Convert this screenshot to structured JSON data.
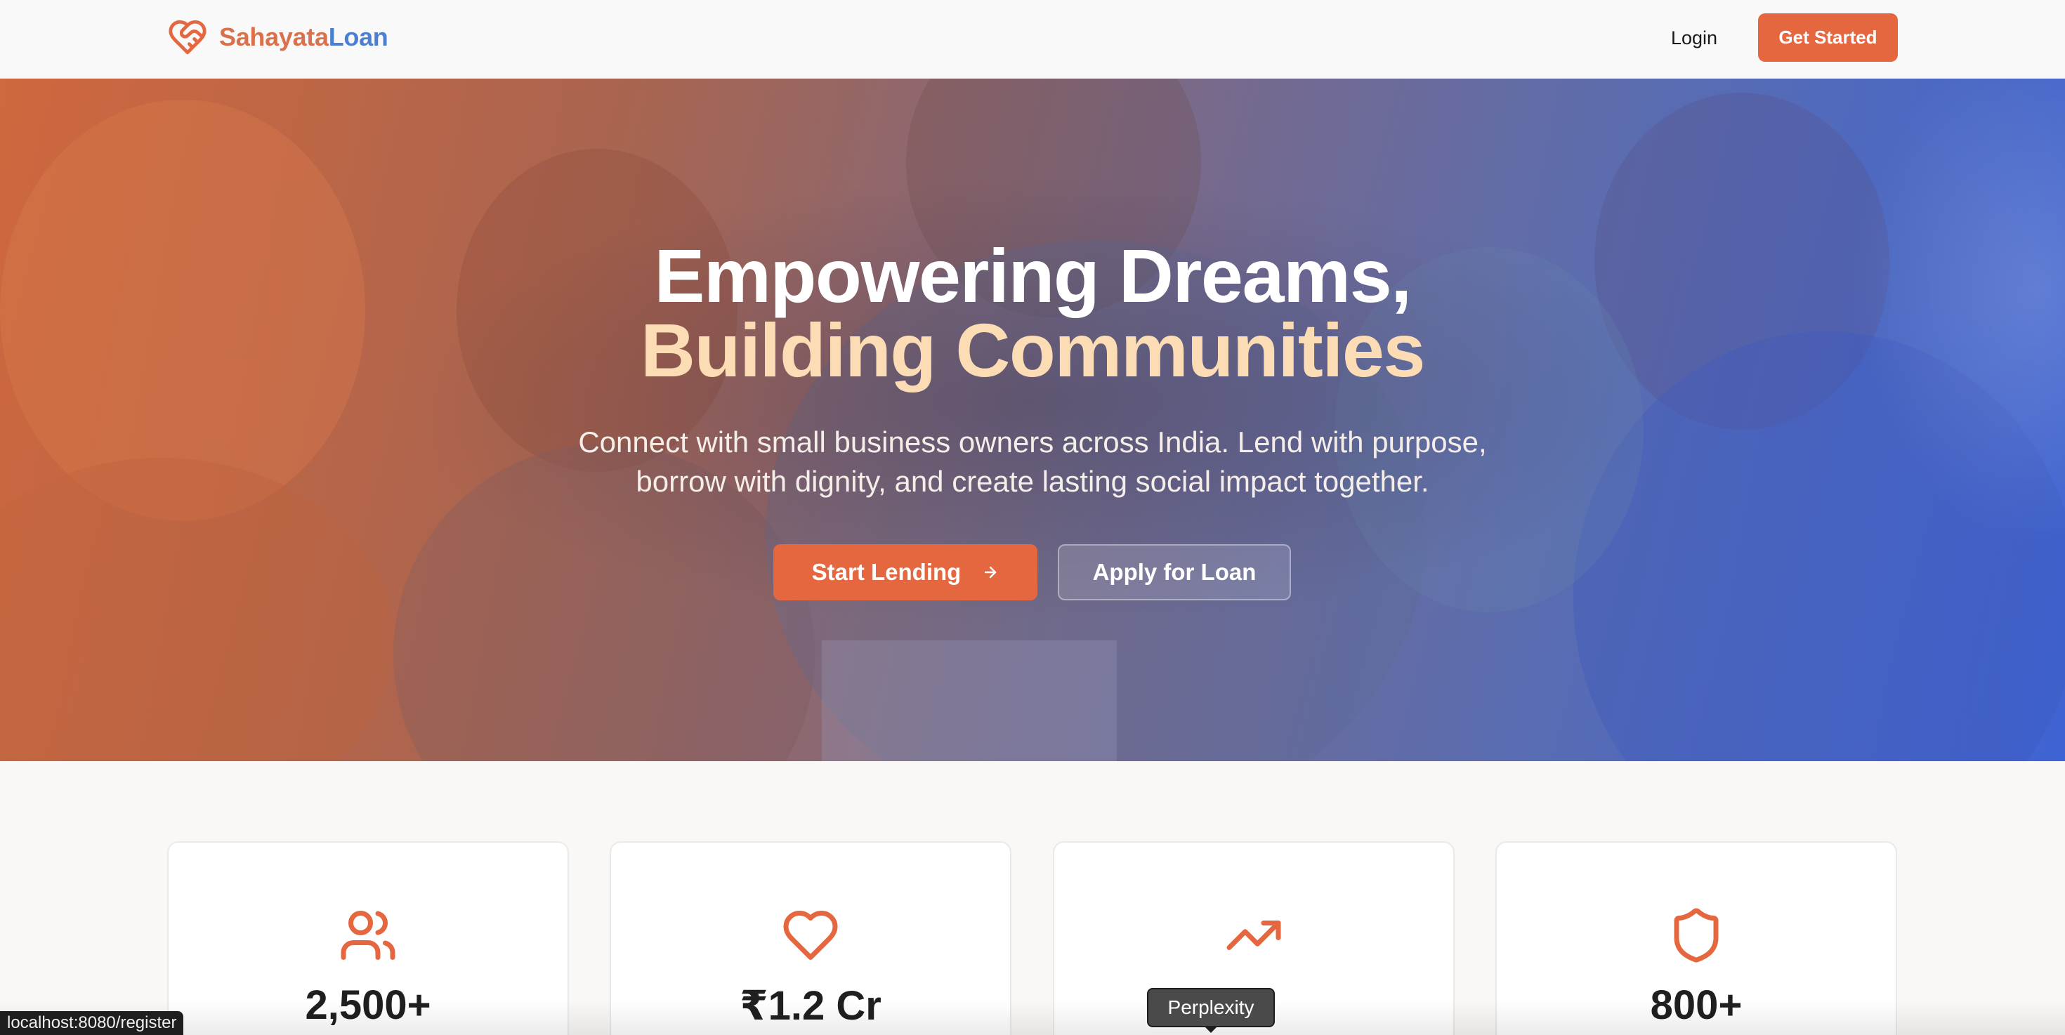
{
  "brand": {
    "name_part1": "Sahayata",
    "name_part2": "Loan",
    "colors": {
      "primary": "#e5673f",
      "brand_orange": "#d9714c",
      "brand_blue": "#4a7fd1"
    }
  },
  "nav": {
    "login_label": "Login",
    "cta_label": "Get Started"
  },
  "hero": {
    "title_line1": "Empowering Dreams,",
    "title_line2": "Building Communities",
    "subtitle": "Connect with small business owners across India. Lend with purpose, borrow with dignity, and create lasting social impact together.",
    "primary_button": "Start Lending",
    "primary_button_icon": "arrow-right-icon",
    "secondary_button": "Apply for Loan"
  },
  "stats": [
    {
      "icon": "users-icon",
      "value": "2,500+"
    },
    {
      "icon": "heart-icon",
      "value": "₹1.2 Cr"
    },
    {
      "icon": "trending-up-icon",
      "value": "%"
    },
    {
      "icon": "shield-icon",
      "value": "800+"
    }
  ],
  "browser": {
    "status_url": "localhost:8080/register",
    "tooltip": "Perplexity"
  }
}
